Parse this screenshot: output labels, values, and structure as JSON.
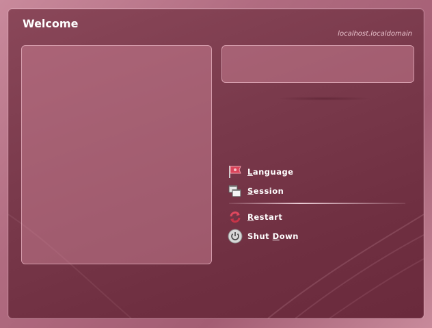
{
  "header": {
    "title": "Welcome",
    "hostname": "localhost.localdomain"
  },
  "menu": {
    "language": {
      "accel": "L",
      "rest": "anguage",
      "icon": "flag-icon"
    },
    "session": {
      "accel": "S",
      "rest": "ession",
      "icon": "session-windows-icon"
    },
    "restart": {
      "accel": "R",
      "rest": "estart",
      "icon": "restart-arrows-icon"
    },
    "shutdown": {
      "pre": "Shut ",
      "accel": "D",
      "rest": "own",
      "icon": "power-icon"
    }
  },
  "colors": {
    "background": "#a35d73",
    "panel": "#7a3a4c",
    "text": "#ffffff",
    "hostname_text": "#e9c3cd"
  }
}
